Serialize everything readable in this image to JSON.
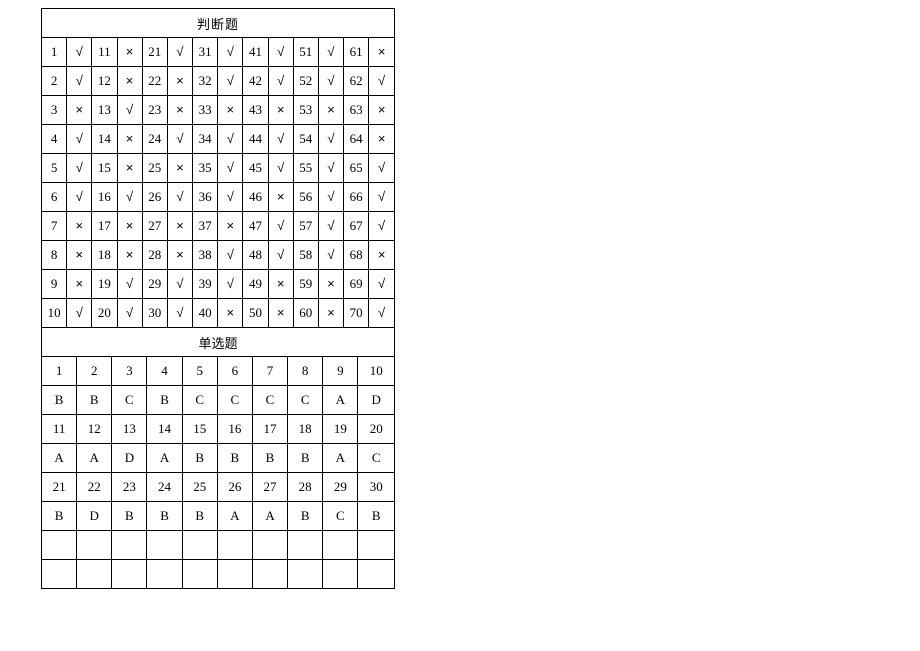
{
  "section1": {
    "title": "判断题",
    "rows": [
      [
        {
          "q": "1",
          "a": "√"
        },
        {
          "q": "11",
          "a": "×"
        },
        {
          "q": "21",
          "a": "√"
        },
        {
          "q": "31",
          "a": "√"
        },
        {
          "q": "41",
          "a": "√"
        },
        {
          "q": "51",
          "a": "√"
        },
        {
          "q": "61",
          "a": "×"
        }
      ],
      [
        {
          "q": "2",
          "a": "√"
        },
        {
          "q": "12",
          "a": "×"
        },
        {
          "q": "22",
          "a": "×"
        },
        {
          "q": "32",
          "a": "√"
        },
        {
          "q": "42",
          "a": "√"
        },
        {
          "q": "52",
          "a": "√"
        },
        {
          "q": "62",
          "a": "√"
        }
      ],
      [
        {
          "q": "3",
          "a": "×"
        },
        {
          "q": "13",
          "a": "√"
        },
        {
          "q": "23",
          "a": "×"
        },
        {
          "q": "33",
          "a": "×"
        },
        {
          "q": "43",
          "a": "×"
        },
        {
          "q": "53",
          "a": "×"
        },
        {
          "q": "63",
          "a": "×"
        }
      ],
      [
        {
          "q": "4",
          "a": "√"
        },
        {
          "q": "14",
          "a": "×"
        },
        {
          "q": "24",
          "a": "√"
        },
        {
          "q": "34",
          "a": "√"
        },
        {
          "q": "44",
          "a": "√"
        },
        {
          "q": "54",
          "a": "√"
        },
        {
          "q": "64",
          "a": "×"
        }
      ],
      [
        {
          "q": "5",
          "a": "√"
        },
        {
          "q": "15",
          "a": "×"
        },
        {
          "q": "25",
          "a": "×"
        },
        {
          "q": "35",
          "a": "√"
        },
        {
          "q": "45",
          "a": "√"
        },
        {
          "q": "55",
          "a": "√"
        },
        {
          "q": "65",
          "a": "√"
        }
      ],
      [
        {
          "q": "6",
          "a": "√"
        },
        {
          "q": "16",
          "a": "√"
        },
        {
          "q": "26",
          "a": "√"
        },
        {
          "q": "36",
          "a": "√"
        },
        {
          "q": "46",
          "a": "×"
        },
        {
          "q": "56",
          "a": "√"
        },
        {
          "q": "66",
          "a": "√"
        }
      ],
      [
        {
          "q": "7",
          "a": "×"
        },
        {
          "q": "17",
          "a": "×"
        },
        {
          "q": "27",
          "a": "×"
        },
        {
          "q": "37",
          "a": "×"
        },
        {
          "q": "47",
          "a": "√"
        },
        {
          "q": "57",
          "a": "√"
        },
        {
          "q": "67",
          "a": "√"
        }
      ],
      [
        {
          "q": "8",
          "a": "×"
        },
        {
          "q": "18",
          "a": "×"
        },
        {
          "q": "28",
          "a": "×"
        },
        {
          "q": "38",
          "a": "√"
        },
        {
          "q": "48",
          "a": "√"
        },
        {
          "q": "58",
          "a": "√"
        },
        {
          "q": "68",
          "a": "×"
        }
      ],
      [
        {
          "q": "9",
          "a": "×"
        },
        {
          "q": "19",
          "a": "√"
        },
        {
          "q": "29",
          "a": "√"
        },
        {
          "q": "39",
          "a": "√"
        },
        {
          "q": "49",
          "a": "×"
        },
        {
          "q": "59",
          "a": "×"
        },
        {
          "q": "69",
          "a": "√"
        }
      ],
      [
        {
          "q": "10",
          "a": "√"
        },
        {
          "q": "20",
          "a": "√"
        },
        {
          "q": "30",
          "a": "√"
        },
        {
          "q": "40",
          "a": "×"
        },
        {
          "q": "50",
          "a": "×"
        },
        {
          "q": "60",
          "a": "×"
        },
        {
          "q": "70",
          "a": "√"
        }
      ]
    ]
  },
  "section2": {
    "title": "单选题",
    "blocks": [
      {
        "nums": [
          "1",
          "2",
          "3",
          "4",
          "5",
          "6",
          "7",
          "8",
          "9",
          "10"
        ],
        "ans": [
          "B",
          "B",
          "C",
          "B",
          "C",
          "C",
          "C",
          "C",
          "A",
          "D"
        ]
      },
      {
        "nums": [
          "11",
          "12",
          "13",
          "14",
          "15",
          "16",
          "17",
          "18",
          "19",
          "20"
        ],
        "ans": [
          "A",
          "A",
          "D",
          "A",
          "B",
          "B",
          "B",
          "B",
          "A",
          "C"
        ]
      },
      {
        "nums": [
          "21",
          "22",
          "23",
          "24",
          "25",
          "26",
          "27",
          "28",
          "29",
          "30"
        ],
        "ans": [
          "B",
          "D",
          "B",
          "B",
          "B",
          "A",
          "A",
          "B",
          "C",
          "B"
        ]
      },
      {
        "nums": [
          "",
          "",
          "",
          "",
          "",
          "",
          "",
          "",
          "",
          ""
        ],
        "ans": [
          "",
          "",
          "",
          "",
          "",
          "",
          "",
          "",
          "",
          ""
        ]
      }
    ]
  }
}
